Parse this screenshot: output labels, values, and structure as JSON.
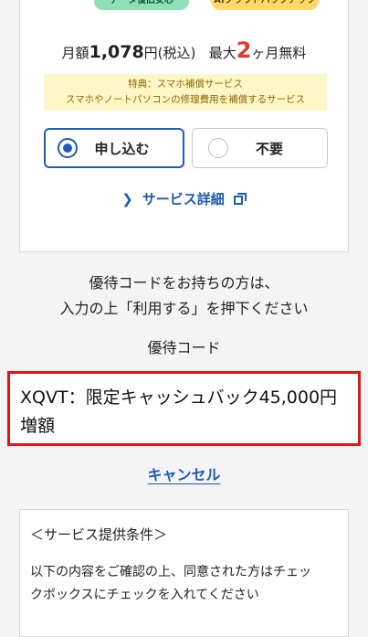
{
  "service_card": {
    "badges": [
      "データ復旧安心",
      "AIクラウドバックアップ"
    ],
    "price": {
      "prefix": "月額",
      "amount": "1,078",
      "suffix": "円(税込)",
      "promo_prefix": "最大",
      "promo_number": "2",
      "promo_suffix": "ヶ月無料"
    },
    "benefit": {
      "line1": "特典：スマホ補償サービス",
      "line2": "スマホやノートパソコンの修理費用を補償するサービス"
    },
    "options": {
      "apply_label": "申し込む",
      "decline_label": "不要",
      "selected": "apply"
    },
    "detail_link": "サービス詳細"
  },
  "coupon": {
    "instruction_line1": "優待コードをお持ちの方は、",
    "instruction_line2": "入力の上「利用する」を押下ください",
    "label": "優待コード",
    "code_text_line1": "XQVT：限定キャッシュバック45,000円",
    "code_text_line2": "増額",
    "cancel_label": "キャンセル"
  },
  "terms": {
    "title": "＜サービス提供条件＞",
    "body_line1": "以下の内容をご確認の上、同意された方はチェッ",
    "body_line2": "クボックスにチェックを入れてください"
  },
  "colors": {
    "accent_blue": "#1e5bb8",
    "alert_red": "#e4131a",
    "promo_red": "#e23b2e",
    "benefit_bg": "#fff6c8"
  }
}
